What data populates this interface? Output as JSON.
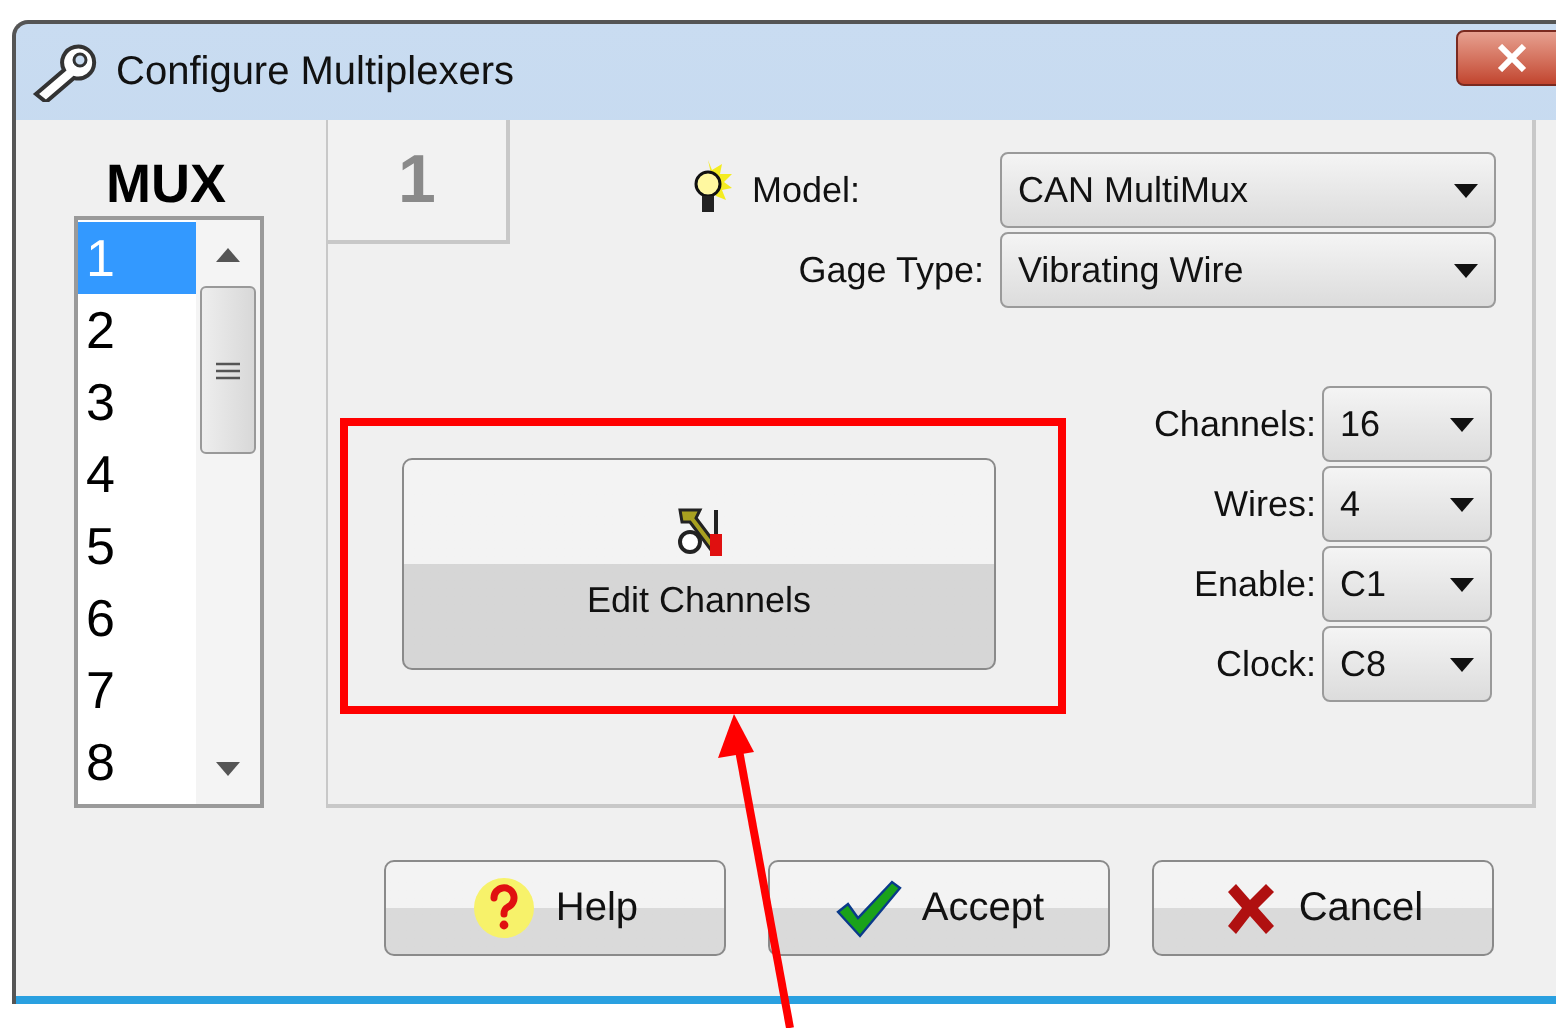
{
  "window": {
    "title": "Configure Multiplexers"
  },
  "mux": {
    "label": "MUX",
    "items": [
      {
        "label": "1",
        "selected": true
      },
      {
        "label": "2",
        "selected": false
      },
      {
        "label": "3",
        "selected": false
      },
      {
        "label": "4",
        "selected": false
      },
      {
        "label": "5",
        "selected": false
      },
      {
        "label": "6",
        "selected": false
      },
      {
        "label": "7",
        "selected": false
      },
      {
        "label": "8",
        "selected": false
      }
    ]
  },
  "tab": {
    "label": "1"
  },
  "model": {
    "label": "Model:",
    "value": "CAN MultiMux"
  },
  "gage_type": {
    "label": "Gage Type:",
    "value": "Vibrating Wire"
  },
  "settings": [
    {
      "label": "Channels:",
      "value": "16"
    },
    {
      "label": "Wires:",
      "value": "4"
    },
    {
      "label": "Enable:",
      "value": "C1"
    },
    {
      "label": "Clock:",
      "value": "C8"
    }
  ],
  "edit_button": {
    "label": "Edit Channels"
  },
  "buttons": [
    {
      "label": "Help",
      "kind": "help"
    },
    {
      "label": "Accept",
      "kind": "accept"
    },
    {
      "label": "Cancel",
      "kind": "cancel"
    }
  ]
}
